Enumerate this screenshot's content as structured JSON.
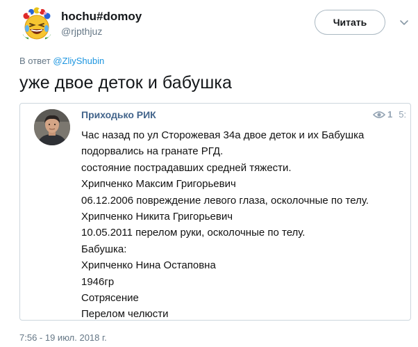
{
  "tweet": {
    "author_name": "hochu#domoy",
    "author_handle": "@rjpthjuz",
    "follow_label": "Читать",
    "reply_prefix": "В ответ ",
    "reply_to": "@ZliyShubin",
    "text": "уже двое деток и бабушка",
    "timestamp": "7:56 - 19 июл. 2018 г."
  },
  "card": {
    "author": "Приходько РИК",
    "views": "1",
    "time_partial": "5:",
    "lines": [
      "Час назад по ул Сторожевая 34а двое деток и их Бабушка",
      "подорвались на гранате РГД.",
      "состояние пострадавших средней тяжести.",
      "Хрипченко Максим Григорьевич",
      "06.12.2006 повреждение левого глаза, осколочные по телу.",
      "Хрипченко Никита Григорьевич",
      "10.05.2011 перелом руки, осколочные по телу.",
      "Бабушка:",
      "Хрипченко Нина Остаповна",
      "1946гр",
      "Сотрясение",
      "Перелом челюсти"
    ]
  },
  "icons": {
    "avatar": "laughing-emoji-avatar-with-flower-wreath",
    "caret": "chevron-down-icon",
    "views": "eye-icon"
  },
  "colors": {
    "link": "#1b95e0",
    "secondary_text": "#657786",
    "vk_author": "#42648b",
    "border": "#ccd6dd"
  }
}
